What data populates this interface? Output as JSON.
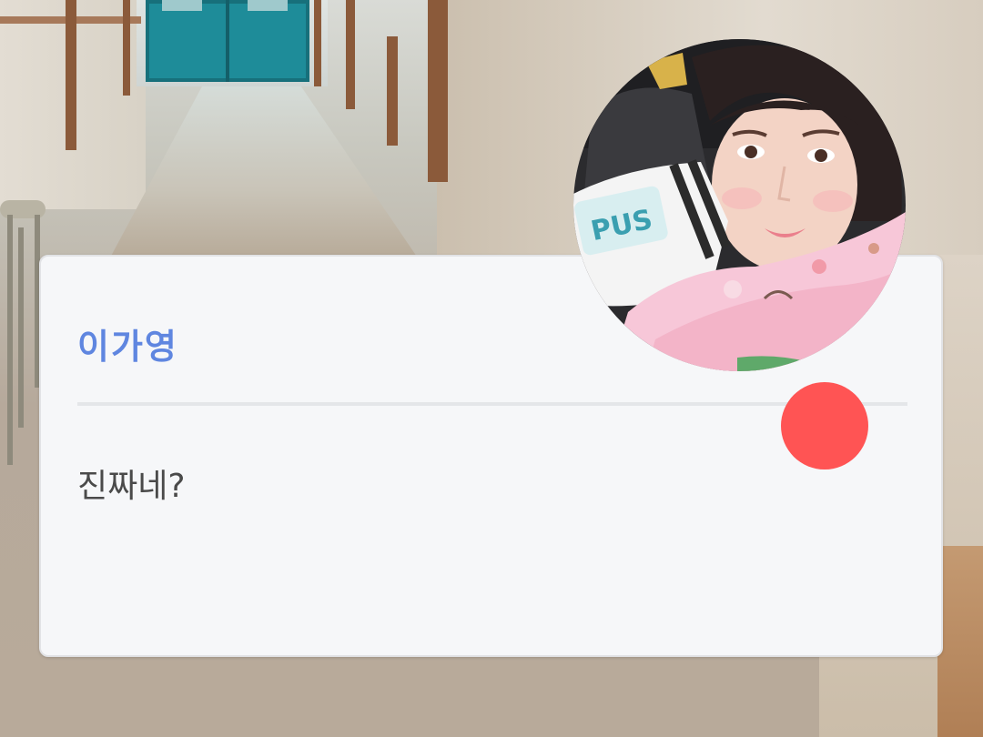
{
  "dialog": {
    "speaker_name": "이가영",
    "message": "진짜네?"
  },
  "avatar": {
    "icon": "character-portrait"
  },
  "indicator": {
    "icon": "red-dot-indicator",
    "color": "#ff5454"
  },
  "colors": {
    "name": "#5f86e0",
    "text": "#4a4a4a",
    "panel": "#f6f7f9",
    "door": "#1e8c99"
  }
}
